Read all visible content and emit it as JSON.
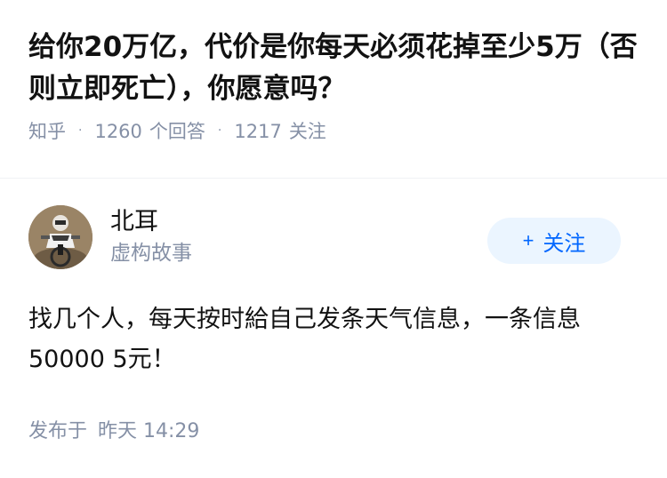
{
  "question": {
    "title": "给你20万亿，代价是你每天必须花掉至少5万（否则立即死亡），你愿意吗？",
    "source": "知乎",
    "answers_count": "1260",
    "answers_label": "个回答",
    "followers_count": "1217",
    "followers_label": "关注",
    "separator": "·"
  },
  "answer": {
    "author_name": "北耳",
    "author_bio": "虚构故事",
    "follow_label": "关注",
    "follow_icon": "plus-icon",
    "content": "找几个人，每天按时給自己发条天气信息，一条信息50000 5元！",
    "published_label": "发布于",
    "published_time": "昨天 14:29"
  },
  "colors": {
    "accent": "#0066ff",
    "follow_bg": "#ebf5ff",
    "meta": "#8590a6",
    "text": "#121212"
  }
}
